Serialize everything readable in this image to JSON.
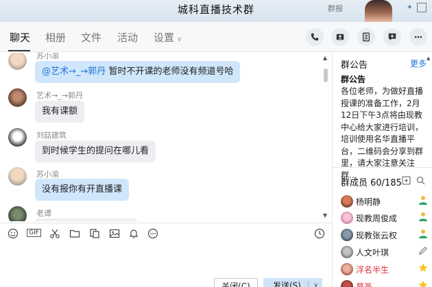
{
  "window": {
    "title": "城科直播技术群",
    "top_right_tag": "群报"
  },
  "tabs": [
    {
      "label": "聊天",
      "active": true
    },
    {
      "label": "相册",
      "active": false
    },
    {
      "label": "文件",
      "active": false
    },
    {
      "label": "活动",
      "active": false
    },
    {
      "label": "设置",
      "active": false
    }
  ],
  "header_actions": [
    "phone-icon",
    "video-call-icon",
    "screen-share-icon",
    "add-app-icon",
    "more-icon"
  ],
  "messages": [
    {
      "sender": "苏小渝",
      "mention": "@艺术→_→郭丹",
      "text": "暂时不开课的老师没有频道号哈",
      "style": "blue"
    },
    {
      "sender": "艺术→_→郭丹",
      "mention": "",
      "text": "我有课额",
      "style": "gray"
    },
    {
      "sender": "刘喆建筑",
      "mention": "",
      "text": "到时候学生的提问在哪儿看",
      "style": "gray"
    },
    {
      "sender": "苏小渝",
      "mention": "",
      "text": "没有报你有开直播课",
      "style": "blue"
    },
    {
      "sender": "老谭",
      "mention": "",
      "text": "",
      "style": "gray"
    }
  ],
  "toolbar_icons": [
    "emoji-icon",
    "gif-icon",
    "scissors-icon",
    "folder-icon",
    "doc-icon",
    "image-icon",
    "bell-icon",
    "more-dots-icon"
  ],
  "buttons": {
    "close": "关闭(C)",
    "send": "发送(S)"
  },
  "announcement": {
    "header": "群公告",
    "more": "更多",
    "title": "群公告",
    "body": "各位老师，为做好直播授课的准备工作，2月12日下午3点将由现教中心给大家进行培训，培训使用名华直播平台，二维码会分享到群里，请大家注意关注群..."
  },
  "members": {
    "header": "群成员 60/185",
    "list": [
      {
        "name": "杨明静",
        "highlight": false,
        "role": "admin"
      },
      {
        "name": "现教周俊成",
        "highlight": false,
        "role": "admin"
      },
      {
        "name": "现教张云权",
        "highlight": false,
        "role": "admin"
      },
      {
        "name": "人文叶琪",
        "highlight": false,
        "role": "edit"
      },
      {
        "name": "浮名半生",
        "highlight": true,
        "role": "star"
      },
      {
        "name": "幕圣",
        "highlight": true,
        "role": "star"
      }
    ]
  },
  "colors": {
    "accent": "#1f73d8",
    "bubble_blue": "#cfe6fb",
    "bubble_gray": "#eceef1",
    "highlight_name": "#e0303a"
  }
}
